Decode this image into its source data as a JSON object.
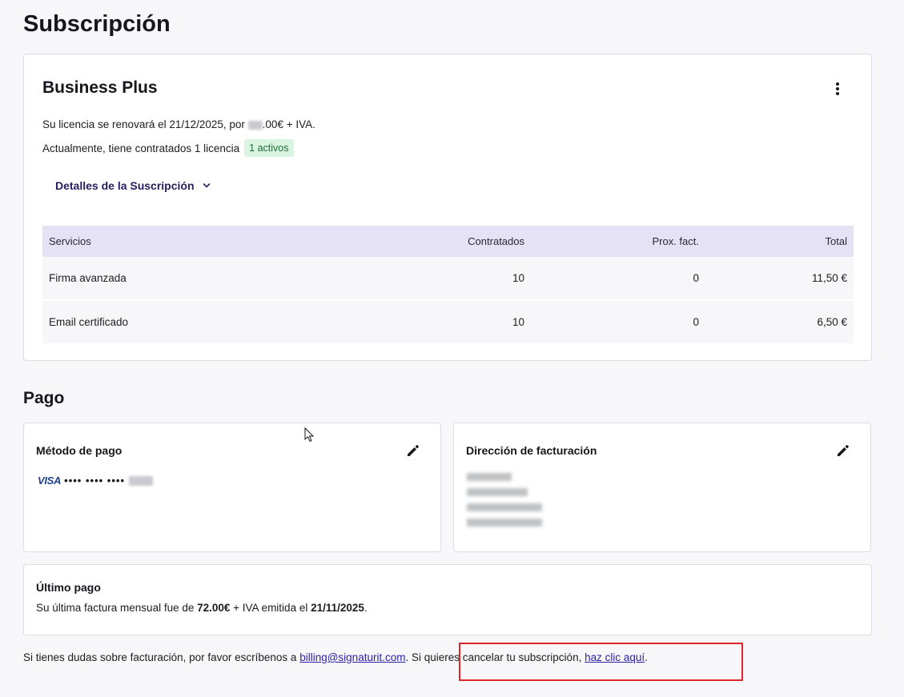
{
  "page": {
    "title": "Subscripción"
  },
  "plan": {
    "name": "Business Plus",
    "menu_icon": "kebab-menu-icon",
    "renew_prefix": "Su licencia se renovará el 21/12/2025, por ",
    "renew_amount_visible": ".00€ + IVA.",
    "licenses_text": "Actualmente, tiene contratados 1 licencia",
    "active_badge": "1 activos",
    "details_label": "Detalles de la Suscripción",
    "details_icon": "chevron-down-icon"
  },
  "services_table": {
    "headers": [
      "Servicios",
      "Contratados",
      "Prox. fact.",
      "Total"
    ],
    "rows": [
      {
        "service": "Firma avanzada",
        "contracted": "10",
        "next_invoice": "0",
        "total": "11,50 €"
      },
      {
        "service": "Email certificado",
        "contracted": "10",
        "next_invoice": "0",
        "total": "6,50 €"
      }
    ]
  },
  "payment": {
    "section_title": "Pago",
    "method": {
      "heading": "Método de pago",
      "edit_icon": "pencil-icon",
      "card_brand": "VISA",
      "card_mask": "•••• •••• •••• "
    },
    "billing_address": {
      "heading": "Dirección de facturación",
      "edit_icon": "pencil-icon"
    },
    "last_payment": {
      "heading": "Último pago",
      "text_1": "Su última factura mensual fue de ",
      "amount": "72.00€",
      "text_2": " + IVA emitida el ",
      "date": "21/11/2025",
      "text_3": "."
    }
  },
  "footer": {
    "text_1": "Si tienes dudas sobre facturación, por favor escríbenos a ",
    "email_link": "billing@signaturit.com",
    "text_2": ". Si quieres cancelar tu subscripción, ",
    "cancel_link": "haz clic aquí",
    "text_3": "."
  },
  "colors": {
    "accent": "#262060",
    "badge_bg": "#d9f5e1",
    "table_header_bg": "#e4e2f4",
    "highlight": "#e0262b",
    "link": "#2b1fa8"
  }
}
